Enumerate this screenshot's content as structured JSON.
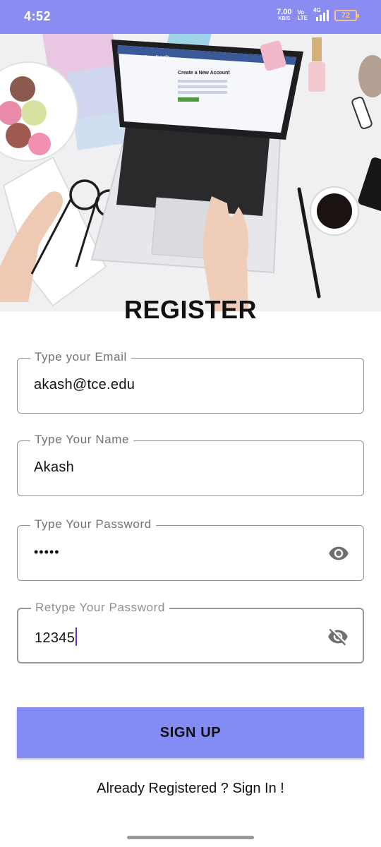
{
  "status_bar": {
    "time": "4:52",
    "net_speed_value": "7.00",
    "net_speed_unit": "KB/S",
    "volte_top": "Vo",
    "volte_bottom": "LTE",
    "signal_label": "4G",
    "battery": "72"
  },
  "hero": {
    "laptop_screen_heading": "Create a New Account",
    "laptop_brand": "facebook"
  },
  "title": "REGISTER",
  "form": {
    "email": {
      "label": "Type your Email",
      "value": "akash@tce.edu"
    },
    "name": {
      "label": "Type Your Name",
      "value": "Akash"
    },
    "password": {
      "label": "Type Your Password",
      "value": "•••••",
      "toggle_icon": "eye-icon"
    },
    "retype_password": {
      "label": "Retype Your Password",
      "value": "12345",
      "toggle_icon": "eye-off-icon"
    }
  },
  "signup_label": "SIGN UP",
  "signin_link": "Already Registered ? Sign In !",
  "colors": {
    "accent": "#838bf4",
    "status_bar": "#8a8cf2",
    "caret": "#5b2bd6"
  }
}
